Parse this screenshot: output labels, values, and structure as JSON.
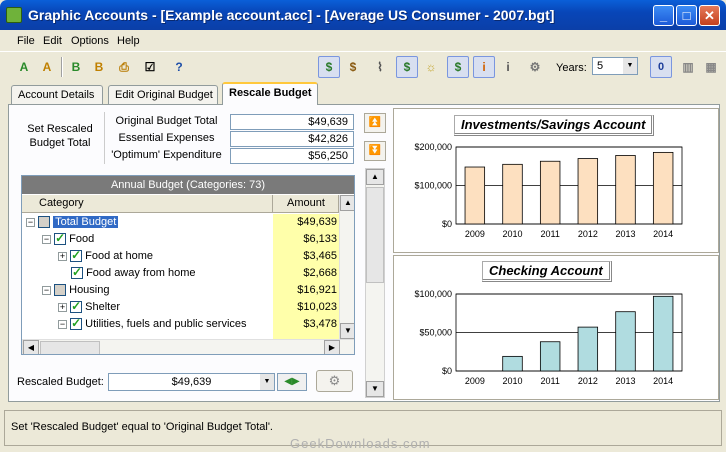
{
  "window": {
    "title": "Graphic Accounts - [Example account.acc] - [Average US Consumer - 2007.bgt]"
  },
  "menu": [
    "File",
    "Edit",
    "Options",
    "Help"
  ],
  "toolbar": {
    "years_label": "Years:",
    "years_value": "5",
    "zero_label": "0"
  },
  "tabs": [
    "Account Details",
    "Edit Original Budget",
    "Rescale Budget"
  ],
  "summary": {
    "group_label": "Set Rescaled Budget Total",
    "rows": [
      {
        "label": "Original Budget Total",
        "value": "$49,639"
      },
      {
        "label": "Essential Expenses",
        "value": "$42,826"
      },
      {
        "label": "'Optimum' Expenditure",
        "value": "$56,250"
      }
    ]
  },
  "tree": {
    "header": "Annual Budget (Categories:  73)",
    "col_category": "Category",
    "col_amount": "Amount",
    "rows": [
      {
        "label": "Total Budget",
        "amount": "$49,639"
      },
      {
        "label": "Food",
        "amount": "$6,133"
      },
      {
        "label": "Food at home",
        "amount": "$3,465"
      },
      {
        "label": "Food away from home",
        "amount": "$2,668"
      },
      {
        "label": "Housing",
        "amount": "$16,921"
      },
      {
        "label": "Shelter",
        "amount": "$10,023"
      },
      {
        "label": "Utilities, fuels and public services",
        "amount": "$3,478"
      }
    ]
  },
  "rescaled": {
    "label": "Rescaled Budget:",
    "value": "$49,639"
  },
  "status": {
    "text": "Set 'Rescaled Budget' equal to 'Original Budget Total'."
  },
  "chart_data": [
    {
      "type": "bar",
      "title": "Investments/Savings Account",
      "categories": [
        "2009",
        "2010",
        "2011",
        "2012",
        "2013",
        "2014"
      ],
      "values": [
        148000,
        155000,
        163000,
        170000,
        178000,
        186000
      ],
      "ylim": [
        0,
        200000
      ],
      "yticks": [
        "$0",
        "$100,000",
        "$200,000"
      ],
      "color": "#fde0c0",
      "grid": true
    },
    {
      "type": "bar",
      "title": "Checking Account",
      "categories": [
        "2009",
        "2010",
        "2011",
        "2012",
        "2013",
        "2014"
      ],
      "values": [
        0,
        19000,
        38000,
        57000,
        77000,
        97000
      ],
      "ylim": [
        0,
        100000
      ],
      "yticks": [
        "$0",
        "$50,000",
        "$100,000"
      ],
      "color": "#b0dce0",
      "grid": true
    }
  ],
  "watermark": "GeekDownloads.com"
}
